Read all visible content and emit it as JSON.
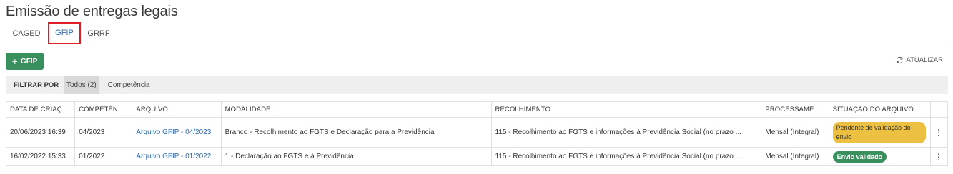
{
  "page": {
    "title": "Emissão de entregas legais"
  },
  "tabs": [
    {
      "label": "CAGED",
      "active": false
    },
    {
      "label": "GFIP",
      "active": true
    },
    {
      "label": "GRRF",
      "active": false
    }
  ],
  "toolbar": {
    "add_label": "GFIP",
    "add_icon": "plus-icon",
    "refresh_label": "ATUALIZAR",
    "refresh_icon": "refresh-icon"
  },
  "filter": {
    "label": "FILTRAR POR",
    "options": [
      {
        "label": "Todos (2)",
        "active": true
      },
      {
        "label": "Competência",
        "active": false
      }
    ]
  },
  "table": {
    "columns": [
      "DATA DE CRIAÇÃO",
      "COMPETÊNCIA",
      "ARQUIVO",
      "MODALIDADE",
      "RECOLHIMENTO",
      "PROCESSAMENTO",
      "SITUAÇÃO DO ARQUIVO"
    ],
    "rows": [
      {
        "data_criacao": "20/06/2023 16:39",
        "competencia": "04/2023",
        "arquivo": "Arquivo GFIP - 04/2023",
        "modalidade": "Branco - Recolhimento ao FGTS e Declaração para a Previdência",
        "recolhimento": "115 - Recolhimento ao FGTS e informações à Previdência Social (no prazo ...",
        "processamento": "Mensal (Integral)",
        "situacao": "Pendente de validação do envio",
        "situacao_color": "#ecc040"
      },
      {
        "data_criacao": "16/02/2022 15:33",
        "competencia": "01/2022",
        "arquivo": "Arquivo GFIP - 01/2022",
        "modalidade": "1 - Declaração ao FGTS e à Previdência",
        "recolhimento": "115 - Recolhimento ao FGTS e informações à Previdência Social (no prazo ...",
        "processamento": "Mensal (Integral)",
        "situacao": "Envio validado",
        "situacao_color": "#3a8f5e"
      }
    ]
  },
  "colors": {
    "primary_green": "#3a8f5e",
    "link_blue": "#2a6db5",
    "highlight_red": "#e11e28",
    "warning_yellow": "#ecc040"
  }
}
